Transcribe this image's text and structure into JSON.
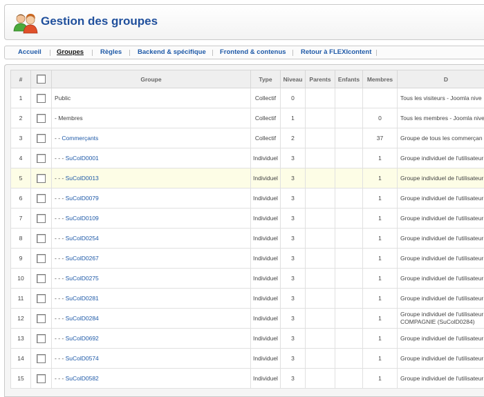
{
  "header": {
    "title": "Gestion des groupes",
    "logo_icon": "users-group-icon"
  },
  "nav": {
    "items": [
      {
        "label": "Accueil",
        "active": false
      },
      {
        "label": "Groupes",
        "active": true
      },
      {
        "label": "Règles",
        "active": false
      },
      {
        "label": "Backend & spécifique",
        "active": false
      },
      {
        "label": "Frontend & contenus",
        "active": false
      },
      {
        "label": "Retour à FLEXIcontent",
        "active": false
      }
    ]
  },
  "table": {
    "headers": {
      "num": "#",
      "group": "Groupe",
      "type": "Type",
      "level": "Niveau",
      "parents": "Parents",
      "children": "Enfants",
      "members": "Membres",
      "description": "D"
    },
    "rows": [
      {
        "num": "1",
        "prefix": "",
        "name": "Public",
        "link": false,
        "type": "Collectif",
        "level": "0",
        "parents": "",
        "children": "",
        "members": "",
        "desc": "Tous les visiteurs - Joomla nive"
      },
      {
        "num": "2",
        "prefix": "- ",
        "name": "Membres",
        "link": false,
        "type": "Collectif",
        "level": "1",
        "parents": "",
        "children": "",
        "members": "0",
        "desc": "Tous les membres - Joomla nive"
      },
      {
        "num": "3",
        "prefix": "- - ",
        "name": "Commerçants",
        "link": true,
        "type": "Collectif",
        "level": "2",
        "parents": "",
        "children": "",
        "members": "37",
        "desc": "Groupe de tous les commerçan"
      },
      {
        "num": "4",
        "prefix": "- - - ",
        "name": "SuColD0001",
        "link": true,
        "type": "Individuel",
        "level": "3",
        "parents": "",
        "children": "",
        "members": "1",
        "desc": "Groupe individuel de l'utilisateur"
      },
      {
        "num": "5",
        "prefix": "- - - ",
        "name": "SuColD0013",
        "link": true,
        "type": "Individuel",
        "level": "3",
        "parents": "",
        "children": "",
        "members": "1",
        "desc": "Groupe individuel de l'utilisateur"
      },
      {
        "num": "6",
        "prefix": "- - - ",
        "name": "SuColD0079",
        "link": true,
        "type": "Individuel",
        "level": "3",
        "parents": "",
        "children": "",
        "members": "1",
        "desc": "Groupe individuel de l'utilisateur"
      },
      {
        "num": "7",
        "prefix": "- - - ",
        "name": "SuColD0109",
        "link": true,
        "type": "Individuel",
        "level": "3",
        "parents": "",
        "children": "",
        "members": "1",
        "desc": "Groupe individuel de l'utilisateur"
      },
      {
        "num": "8",
        "prefix": "- - - ",
        "name": "SuColD0254",
        "link": true,
        "type": "Individuel",
        "level": "3",
        "parents": "",
        "children": "",
        "members": "1",
        "desc": "Groupe individuel de l'utilisateur"
      },
      {
        "num": "9",
        "prefix": "- - - ",
        "name": "SuColD0267",
        "link": true,
        "type": "Individuel",
        "level": "3",
        "parents": "",
        "children": "",
        "members": "1",
        "desc": "Groupe individuel de l'utilisateur"
      },
      {
        "num": "10",
        "prefix": "- - - ",
        "name": "SuColD0275",
        "link": true,
        "type": "Individuel",
        "level": "3",
        "parents": "",
        "children": "",
        "members": "1",
        "desc": "Groupe individuel de l'utilisateur"
      },
      {
        "num": "11",
        "prefix": "- - - ",
        "name": "SuColD0281",
        "link": true,
        "type": "Individuel",
        "level": "3",
        "parents": "",
        "children": "",
        "members": "1",
        "desc": "Groupe individuel de l'utilisateur"
      },
      {
        "num": "12",
        "prefix": "- - - ",
        "name": "SuColD0284",
        "link": true,
        "type": "Individuel",
        "level": "3",
        "parents": "",
        "children": "",
        "members": "1",
        "desc": "Groupe individuel de l'utilisateur COMPAGNIE (SuColD0284)"
      },
      {
        "num": "13",
        "prefix": "- - - ",
        "name": "SuColD0692",
        "link": true,
        "type": "Individuel",
        "level": "3",
        "parents": "",
        "children": "",
        "members": "1",
        "desc": "Groupe individuel de l'utilisateur"
      },
      {
        "num": "14",
        "prefix": "- - - ",
        "name": "SuColD0574",
        "link": true,
        "type": "Individuel",
        "level": "3",
        "parents": "",
        "children": "",
        "members": "1",
        "desc": "Groupe individuel de l'utilisateur"
      },
      {
        "num": "15",
        "prefix": "- - - ",
        "name": "SuColD0582",
        "link": true,
        "type": "Individuel",
        "level": "3",
        "parents": "",
        "children": "",
        "members": "1",
        "desc": "Groupe individuel de l'utilisateur"
      }
    ],
    "highlighted_row": 5
  }
}
